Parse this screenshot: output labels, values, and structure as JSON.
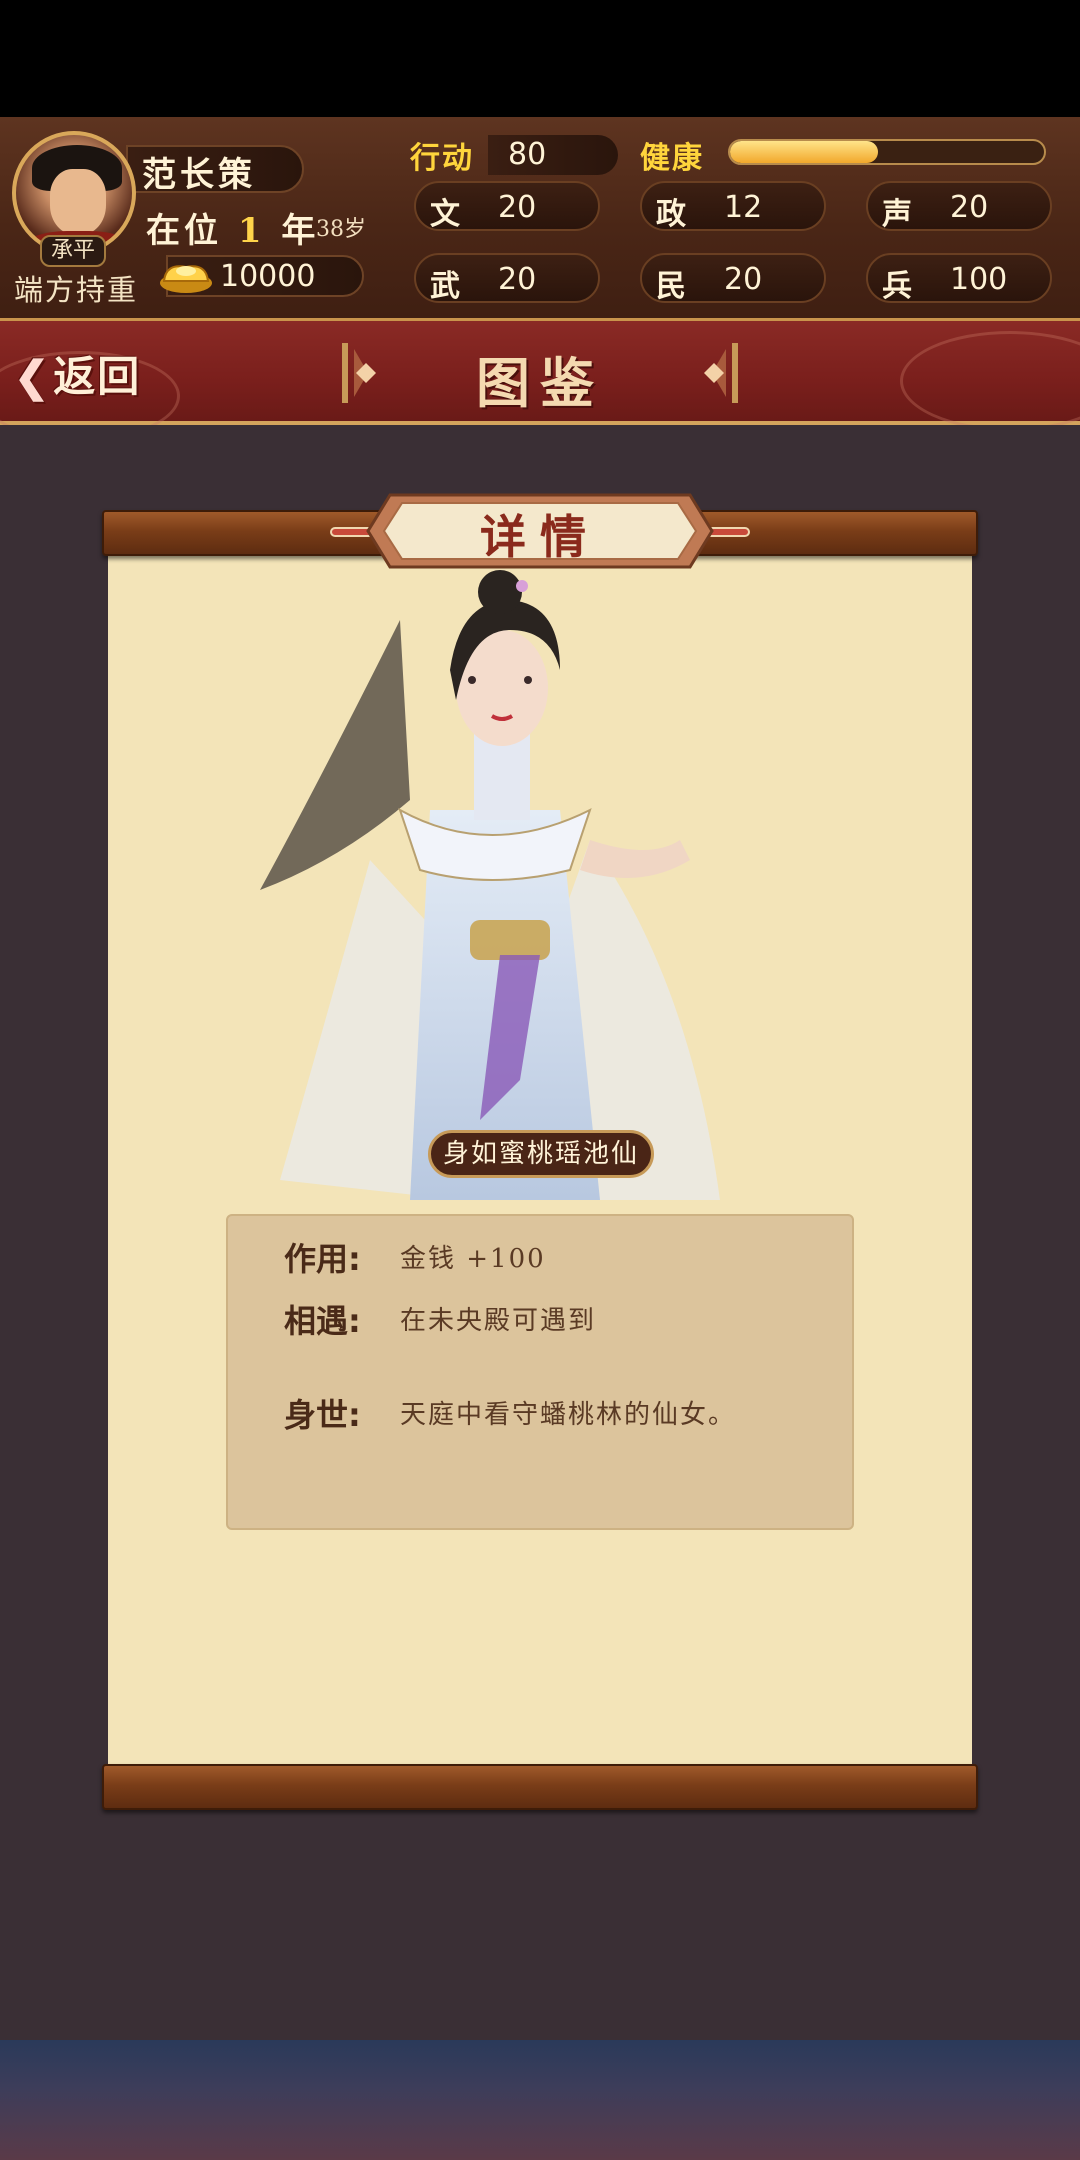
{
  "player": {
    "name": "范长策",
    "reign_prefix": "在位",
    "reign_years": "1",
    "reign_suffix": "年",
    "age": "38岁",
    "title": "承平",
    "trait": "端方持重",
    "gold": "10000"
  },
  "stats": {
    "action_label": "行动",
    "action_value": "80",
    "health_label": "健康",
    "health_fraction": 0.47,
    "items": [
      {
        "label": "文",
        "value": "20"
      },
      {
        "label": "政",
        "value": "12"
      },
      {
        "label": "声",
        "value": "20"
      },
      {
        "label": "武",
        "value": "20"
      },
      {
        "label": "民",
        "value": "20"
      },
      {
        "label": "兵",
        "value": "100"
      }
    ]
  },
  "nav": {
    "back_label": "返回",
    "back_icon": "chevron-left-icon",
    "title": "图鉴"
  },
  "detail": {
    "header": "详情",
    "character_name": "身如蜜桃瑶池仙",
    "rows": [
      {
        "label": "作用:",
        "value": "金钱 +100"
      },
      {
        "label": "相遇:",
        "value": "在未央殿可遇到"
      },
      {
        "label": "身世:",
        "value": "天庭中看守蟠桃林的仙女。"
      }
    ]
  },
  "colors": {
    "accent_gold": "#ffd53c",
    "nav_red": "#7a1f1c",
    "paper": "#f3e4b8",
    "wood": "#7a3d18"
  }
}
